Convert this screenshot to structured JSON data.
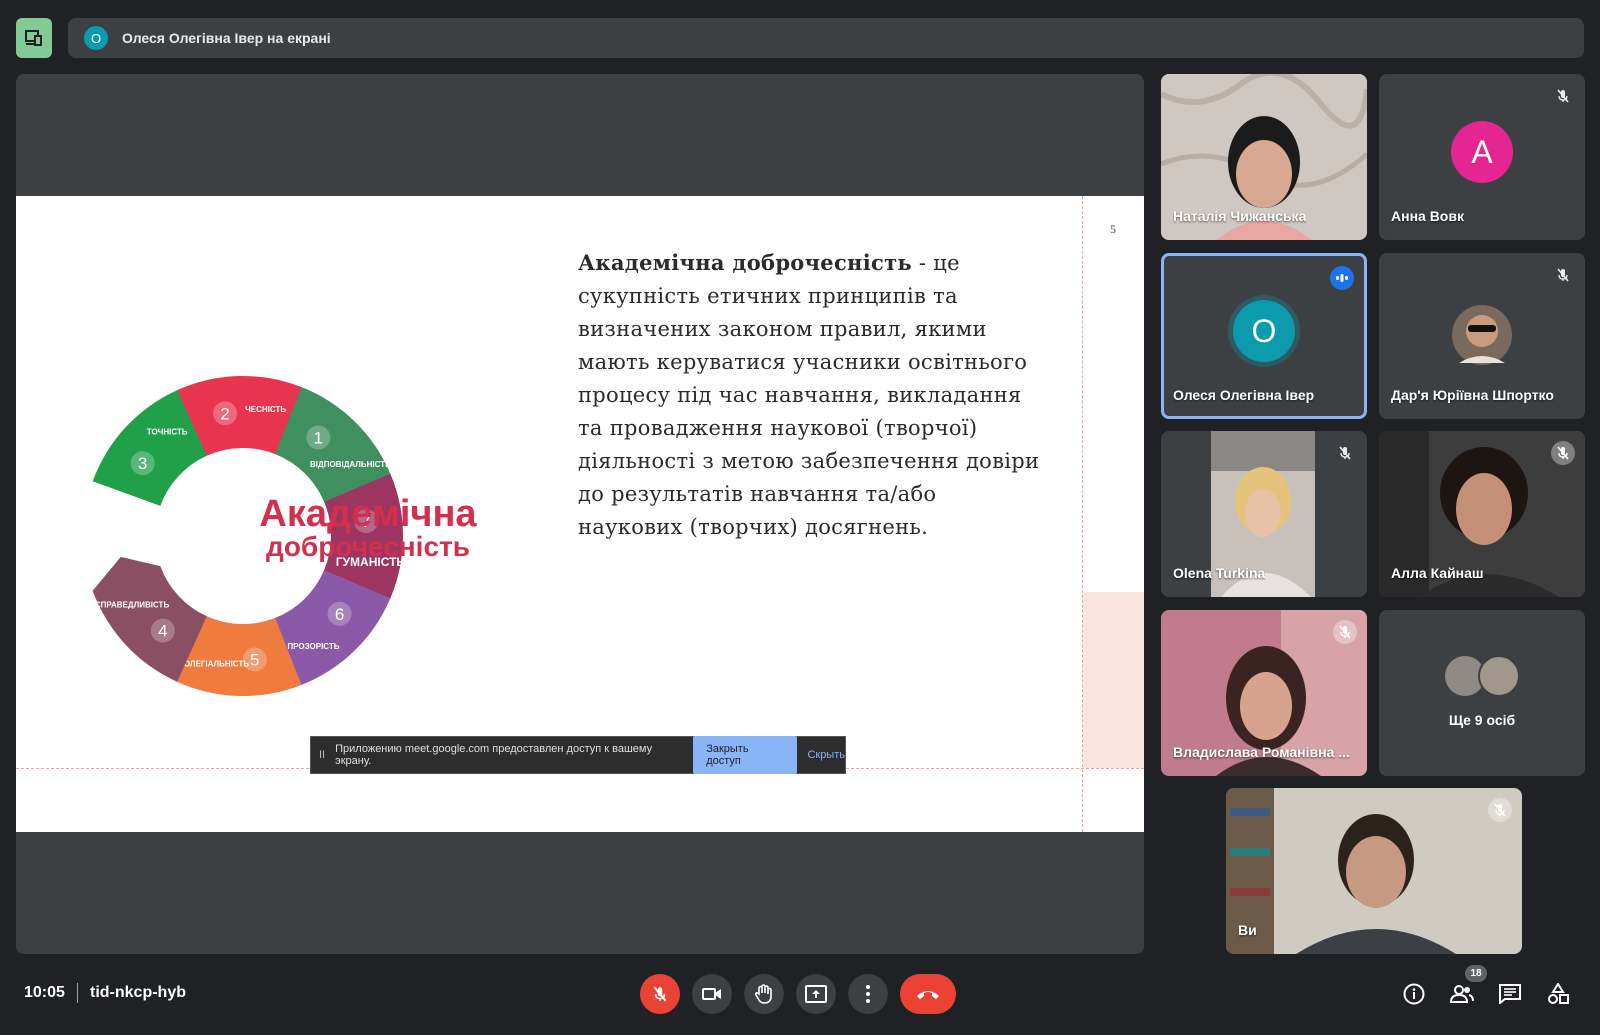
{
  "top_bar": {
    "presenter_initial": "О",
    "presenter_text": "Олеся Олегівна Івер на екрані"
  },
  "slide": {
    "page_number": "5",
    "heading": "Академічна доброчесність",
    "body": " - це сукупність етичних принципів та визначених законом правил, якими мають керуватися учасники освітнього процесу під час навчання, викладання та провадження наукової (творчої) діяльності з метою забезпечення довіри до результатів навчання та/або наукових (творчих) досягнень.",
    "diagram": {
      "title_line1": "Академічна",
      "title_line2": "доброчесність",
      "segments": [
        {
          "num": "1",
          "label": "ВІДПОВІДАЛЬНІСТЬ",
          "color": "#3f8f5f"
        },
        {
          "num": "2",
          "label": "ЧЕСНІСТЬ",
          "color": "#e8344f"
        },
        {
          "num": "3",
          "label": "ТОЧНІСТЬ",
          "color": "#21a04a"
        },
        {
          "num": "4",
          "label": "СПРАВЕДЛИВІСТЬ",
          "color": "#8a4f63"
        },
        {
          "num": "5",
          "label": "КОЛЕГІАЛЬНІСТЬ",
          "color": "#f07b3f"
        },
        {
          "num": "6",
          "label": "ПРОЗОРІСТЬ",
          "color": "#8a5aa8"
        },
        {
          "num": "7",
          "label": "ГУМАНІСТЬ",
          "color": "#9c3560"
        }
      ]
    }
  },
  "share_bar": {
    "pause": "II",
    "message": "Приложению meet.google.com предоставлен доступ к вашему экрану.",
    "stop_label": "Закрыть доступ",
    "hide_label": "Скрыть"
  },
  "participants": [
    {
      "name": "Наталія Чижанська",
      "type": "video",
      "muted": false
    },
    {
      "name": "Анна Вовк",
      "type": "avatar",
      "initial": "А",
      "avatar_color": "#e52592",
      "muted": true
    },
    {
      "name": "Олеся Олегівна Івер",
      "type": "avatar",
      "initial": "О",
      "avatar_color": "#0b9bad",
      "speaking": true,
      "active": true
    },
    {
      "name": "Дар'я Юріївна Шпортко",
      "type": "photo",
      "muted": true
    },
    {
      "name": "Olena Turkina",
      "type": "video",
      "muted": true
    },
    {
      "name": "Алла Кайнаш",
      "type": "video",
      "muted": true
    },
    {
      "name": "Владислава Романівна ...",
      "type": "video",
      "muted": true
    },
    {
      "name": "Ще 9 осіб",
      "type": "group"
    },
    {
      "name": "Ви",
      "type": "video",
      "muted": true
    }
  ],
  "bottom_bar": {
    "time": "10:05",
    "meeting_code": "tid-nkcp-hyb",
    "people_count": "18"
  },
  "colors": {
    "background": "#202124",
    "tile": "#3c4043",
    "danger": "#ea4335",
    "accent": "#8ab4f8"
  }
}
